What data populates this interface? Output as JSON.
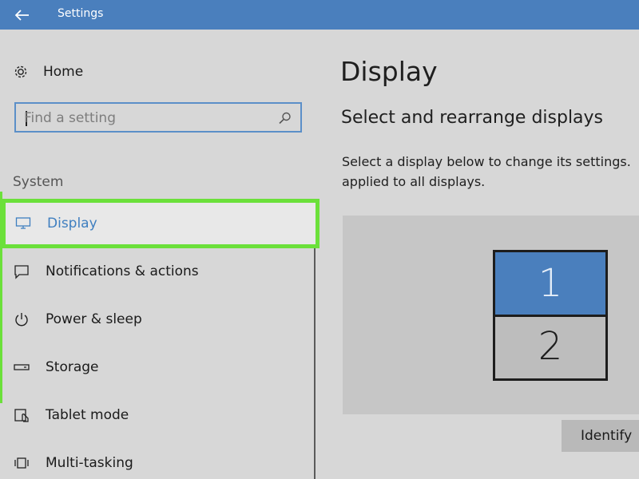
{
  "window": {
    "title": "Settings",
    "accent_color": "#4a7fbd"
  },
  "sidebar": {
    "home_label": "Home",
    "search": {
      "placeholder": "Find a setting"
    },
    "section_heading": "System",
    "items": [
      {
        "label": "Display",
        "icon": "monitor-icon",
        "active": true
      },
      {
        "label": "Notifications & actions",
        "icon": "notification-icon"
      },
      {
        "label": "Power & sleep",
        "icon": "power-icon"
      },
      {
        "label": "Storage",
        "icon": "storage-icon"
      },
      {
        "label": "Tablet mode",
        "icon": "tablet-mode-icon"
      },
      {
        "label": "Multi-tasking",
        "icon": "multitasking-icon"
      }
    ],
    "highlight_color": "#6be03a"
  },
  "main": {
    "title": "Display",
    "subtitle": "Select and rearrange displays",
    "description_line1": "Select a display below to change its settings.",
    "description_line2": "applied to all displays.",
    "displays": [
      {
        "label": "1",
        "selected": true
      },
      {
        "label": "2",
        "selected": false
      }
    ],
    "identify_label": "Identify"
  }
}
